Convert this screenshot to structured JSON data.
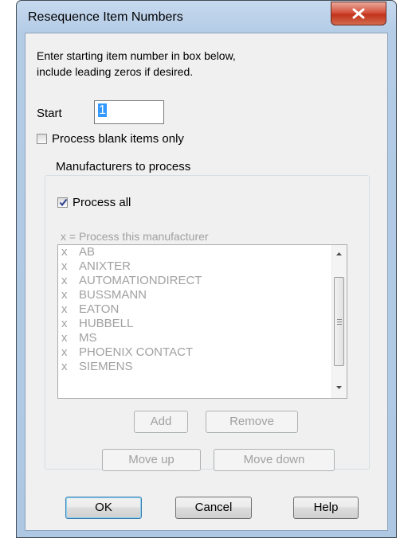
{
  "window": {
    "title": "Resequence Item Numbers"
  },
  "instructions": {
    "line1": "Enter starting item number in box below,",
    "line2": "include leading zeros if desired."
  },
  "start": {
    "label": "Start",
    "value": "1"
  },
  "blank_only": {
    "label": "Process blank items only",
    "checked": false
  },
  "manufacturers": {
    "group_label": "Manufacturers to process",
    "process_all": {
      "label": "Process all",
      "checked": true
    },
    "hint": "x = Process this manufacturer",
    "items": [
      {
        "mark": "x",
        "name": "AB"
      },
      {
        "mark": "x",
        "name": "ANIXTER"
      },
      {
        "mark": "x",
        "name": "AUTOMATIONDIRECT"
      },
      {
        "mark": "x",
        "name": "BUSSMANN"
      },
      {
        "mark": "x",
        "name": "EATON"
      },
      {
        "mark": "x",
        "name": "HUBBELL"
      },
      {
        "mark": "x",
        "name": "MS"
      },
      {
        "mark": "x",
        "name": "PHOENIX CONTACT"
      },
      {
        "mark": "x",
        "name": "SIEMENS"
      }
    ],
    "add_label": "Add",
    "remove_label": "Remove",
    "move_up_label": "Move up",
    "move_down_label": "Move down"
  },
  "footer": {
    "ok_label": "OK",
    "cancel_label": "Cancel",
    "help_label": "Help"
  }
}
